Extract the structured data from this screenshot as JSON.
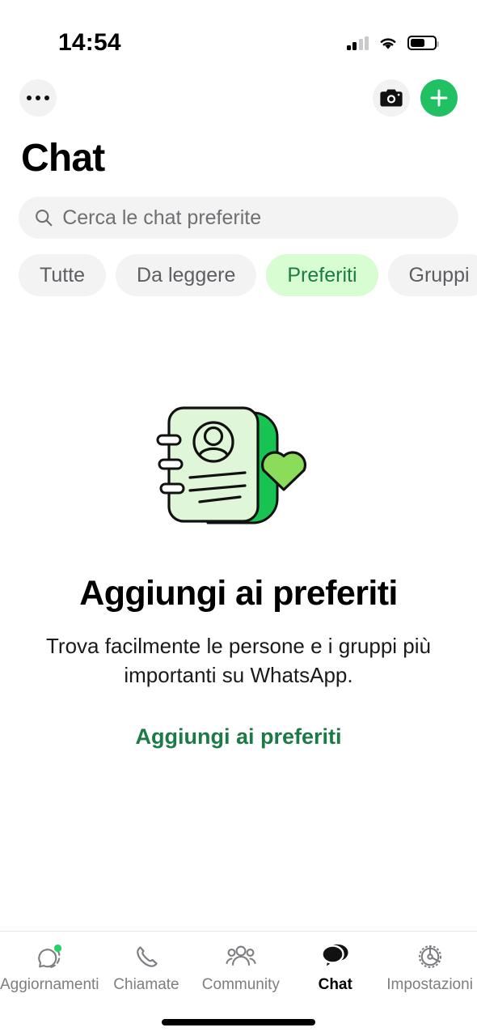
{
  "status_bar": {
    "time": "14:54",
    "cellular_icon": "cellular-signal-icon",
    "wifi_icon": "wifi-icon",
    "battery_icon": "battery-icon",
    "battery_level": 62
  },
  "top_nav": {
    "menu_icon": "more-options-icon",
    "camera_icon": "camera-icon",
    "new_chat_icon": "plus-icon"
  },
  "header": {
    "title": "Chat"
  },
  "search": {
    "placeholder": "Cerca le chat preferite",
    "value": "",
    "icon": "search-icon"
  },
  "filters": [
    {
      "label": "Tutte",
      "active": false
    },
    {
      "label": "Da leggere",
      "active": false
    },
    {
      "label": "Preferiti",
      "active": true
    },
    {
      "label": "Gruppi",
      "active": false
    }
  ],
  "empty_state": {
    "illustration": "favorites-contact-card-heart-illustration",
    "title": "Aggiungi ai preferiti",
    "body": "Trova facilmente le persone e i gruppi più importanti su WhatsApp.",
    "action_label": "Aggiungi ai preferiti"
  },
  "tabs": [
    {
      "label": "Aggiornamenti",
      "icon": "updates-status-icon",
      "active": false,
      "badge": true
    },
    {
      "label": "Chiamate",
      "icon": "phone-icon",
      "active": false,
      "badge": false
    },
    {
      "label": "Community",
      "icon": "community-people-icon",
      "active": false,
      "badge": false
    },
    {
      "label": "Chat",
      "icon": "chats-bubbles-icon",
      "active": true,
      "badge": false
    },
    {
      "label": "Impostazioni",
      "icon": "settings-gear-icon",
      "active": false,
      "badge": false
    }
  ],
  "colors": {
    "brand_green": "#21C063",
    "chip_active_bg": "#D9FDD3",
    "chip_active_text": "#1C7A46",
    "link_green": "#1C7A46",
    "badge_green": "#25D366",
    "card_front": "#DFF7D8",
    "card_back": "#17C452",
    "heart": "#8BDC5A",
    "field_bg": "#F3F3F3"
  },
  "home_indicator": "home-indicator-bar"
}
